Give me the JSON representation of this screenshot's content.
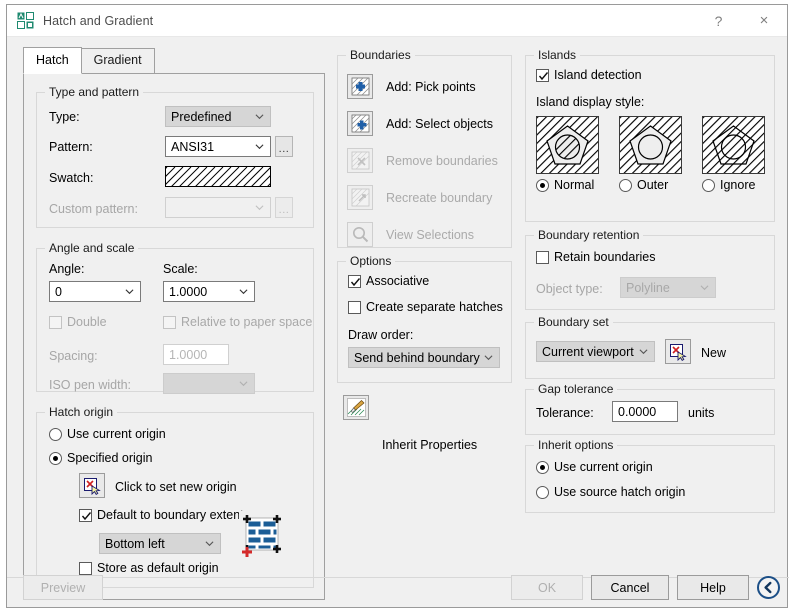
{
  "window": {
    "title": "Hatch and Gradient",
    "app_icon": "autocad-hatch-icon",
    "help_button": "?",
    "close_button": "×"
  },
  "tabs": [
    {
      "label": "Hatch",
      "active": true
    },
    {
      "label": "Gradient",
      "active": false
    }
  ],
  "type_and_pattern": {
    "legend": "Type and pattern",
    "type_label": "Type:",
    "type_value": "Predefined",
    "pattern_label": "Pattern:",
    "pattern_value": "ANSI31",
    "pattern_browse": "...",
    "swatch_label": "Swatch:",
    "swatch_pattern": "ANSI31",
    "custom_pattern_label": "Custom pattern:",
    "custom_pattern_value": "",
    "custom_browse": "..."
  },
  "angle_and_scale": {
    "legend": "Angle and scale",
    "angle_label": "Angle:",
    "angle_value": "0",
    "scale_label": "Scale:",
    "scale_value": "1.0000",
    "double_label": "Double",
    "double_checked": false,
    "relative_label": "Relative to paper space",
    "relative_checked": false,
    "spacing_label": "Spacing:",
    "spacing_value": "1.0000",
    "iso_pen_label": "ISO pen width:",
    "iso_pen_value": ""
  },
  "hatch_origin": {
    "legend": "Hatch origin",
    "use_current_label": "Use current origin",
    "use_current_selected": false,
    "specified_label": "Specified origin",
    "specified_selected": true,
    "click_set_label": "Click to set new origin",
    "click_set_icon": "set-origin-icon",
    "default_extents_label": "Default to boundary extents",
    "default_extents_checked": true,
    "extents_value": "Bottom left",
    "preview_icon": "brick-origin-preview-icon",
    "store_default_label": "Store as default origin",
    "store_default_checked": false
  },
  "boundaries": {
    "legend": "Boundaries",
    "items": [
      {
        "label": "Add: Pick points",
        "icon": "pick-points-icon",
        "enabled": true
      },
      {
        "label": "Add: Select objects",
        "icon": "select-objects-icon",
        "enabled": true
      },
      {
        "label": "Remove boundaries",
        "icon": "remove-boundaries-icon",
        "enabled": false
      },
      {
        "label": "Recreate boundary",
        "icon": "recreate-boundary-icon",
        "enabled": false
      },
      {
        "label": "View Selections",
        "icon": "magnifier-icon",
        "enabled": false
      }
    ]
  },
  "options": {
    "legend": "Options",
    "associative_label": "Associative",
    "associative_checked": true,
    "separate_hatches_label": "Create separate hatches",
    "separate_hatches_checked": false,
    "draw_order_label": "Draw order:",
    "draw_order_value": "Send behind boundary",
    "inherit_properties_label": "Inherit Properties",
    "inherit_properties_icon": "paintbrush-icon"
  },
  "islands": {
    "legend": "Islands",
    "detection_label": "Island detection",
    "detection_checked": true,
    "display_style_label": "Island display style:",
    "styles": [
      {
        "label": "Normal",
        "selected": true,
        "icon": "island-normal-preview"
      },
      {
        "label": "Outer",
        "selected": false,
        "icon": "island-outer-preview"
      },
      {
        "label": "Ignore",
        "selected": false,
        "icon": "island-ignore-preview"
      }
    ]
  },
  "boundary_retention": {
    "legend": "Boundary retention",
    "retain_label": "Retain boundaries",
    "retain_checked": false,
    "object_type_label": "Object type:",
    "object_type_value": "Polyline"
  },
  "boundary_set": {
    "legend": "Boundary set",
    "value": "Current viewport",
    "new_button_label": "New",
    "new_button_icon": "set-boundary-icon"
  },
  "gap_tolerance": {
    "legend": "Gap tolerance",
    "tolerance_label": "Tolerance:",
    "tolerance_value": "0.0000",
    "units_label": "units"
  },
  "inherit_options": {
    "legend": "Inherit options",
    "use_current_label": "Use current origin",
    "use_current_selected": true,
    "use_source_label": "Use source hatch origin",
    "use_source_selected": false
  },
  "footer": {
    "preview_label": "Preview",
    "preview_enabled": false,
    "ok_label": "OK",
    "ok_enabled": false,
    "cancel_label": "Cancel",
    "help_label": "Help",
    "expand_icon": "chevron-left-circle-icon"
  },
  "colors": {
    "dialog_bg": "#f0f0f0",
    "titlebar_bg": "#ffffff",
    "accent_blue": "#1c4f87",
    "icon_teal": "#1f8a70",
    "disabled_text": "#a8a8a8"
  }
}
